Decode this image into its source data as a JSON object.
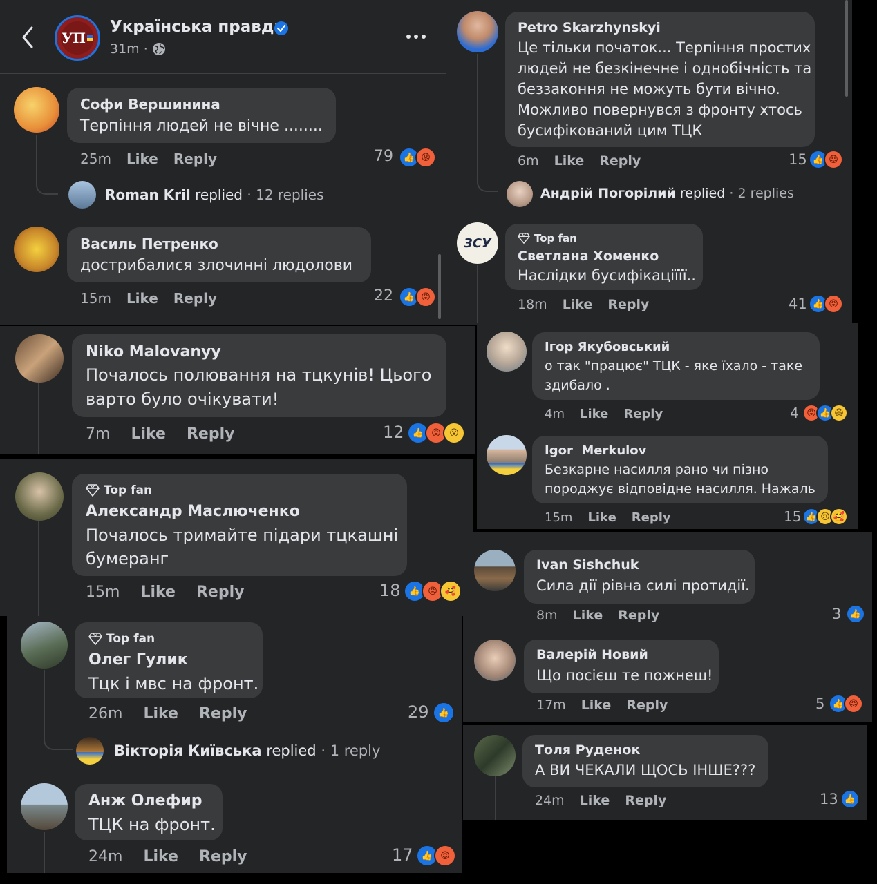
{
  "header": {
    "page_name": "Українська правда",
    "logo_text": "УП",
    "meta_time": "31m",
    "meta_sep": "·"
  },
  "labels": {
    "like": "Like",
    "reply": "Reply",
    "top_fan": "Top fan",
    "replied": "replied",
    "dot": "·"
  },
  "comments": {
    "sofi": {
      "name": "Софи Вершинина",
      "text": "Терпіння людей не вічне ........",
      "time": "25m",
      "count": "79"
    },
    "roman": {
      "name": "Roman Kril",
      "replies": "12 replies"
    },
    "vasyl": {
      "name": "Василь Петренко",
      "text": "дострибалися злочинні людолови",
      "time": "15m",
      "count": "22"
    },
    "niko": {
      "name": "Niko Malovanyy",
      "text1": "Почалось полювання на тцкунів! Цього",
      "text2": "варто було очікувати!",
      "time": "7m",
      "count": "12"
    },
    "olexandr": {
      "name": "Александр Маслюченко",
      "text1": "Почалось тримайте підари тцкашні",
      "text2": "бумеранг",
      "time": "15m",
      "count": "18"
    },
    "oleh": {
      "name": "Олег Гулик",
      "text": "Тцк і мвс на фронт.",
      "time": "26m",
      "count": "29"
    },
    "viktoria": {
      "name": "Вікторія Київська",
      "replies": "1 reply"
    },
    "anzh": {
      "name": "Анж Олефир",
      "text": "ТЦК на фронт.",
      "time": "24m",
      "count": "17"
    },
    "petro": {
      "name": "Petro Skarzhynskyi",
      "text1": "Це тільки початок... Терпіння простих",
      "text2": "людей не безкінечне і однобічність та",
      "text3": "беззаконня не можуть бути вічно.",
      "text4": "Можливо повернувся з фронту хтось",
      "text5": "бусифікований цим ТЦК",
      "time": "6m",
      "count": "15"
    },
    "andrii": {
      "name": "Андрій Погорілий",
      "replies": "2 replies"
    },
    "svitlana": {
      "name": "Светлана Хоменко",
      "text": "Наслідки бусифікаціїїї..",
      "time": "18m",
      "count": "41",
      "avatar_text": "ЗСУ"
    },
    "ihor": {
      "name": "Ігор Якубовський",
      "text1": "о так \"працює\" ТЦК - яке їхало - таке",
      "text2": "здибало .",
      "time": "4m",
      "count": "4"
    },
    "igor": {
      "name": "Igor  Merkulov",
      "text1": "Безкарне насилля рано чи пізно",
      "text2": "породжує відповідне насилля. Нажаль",
      "time": "15m",
      "count": "15"
    },
    "ivan": {
      "name": "Ivan Sishchuk",
      "text": "Сила дії рівна силі протидії.",
      "time": "8m",
      "count": "3"
    },
    "valerii": {
      "name": "Валерій Новий",
      "text": "Що посієш те пожнеш!",
      "time": "17m",
      "count": "5"
    },
    "tolia": {
      "name": "Толя Руденок",
      "text": "А ВИ ЧЕКАЛИ ЩОСЬ ІНШЕ???",
      "time": "24m",
      "count": "13"
    }
  },
  "colors": {
    "panel_bg": "#242526",
    "bubble_bg": "#3a3b3c",
    "like_blue": "#1b74e4",
    "verified_blue": "#1b74e4",
    "logo_red": "#8e1d1d"
  }
}
